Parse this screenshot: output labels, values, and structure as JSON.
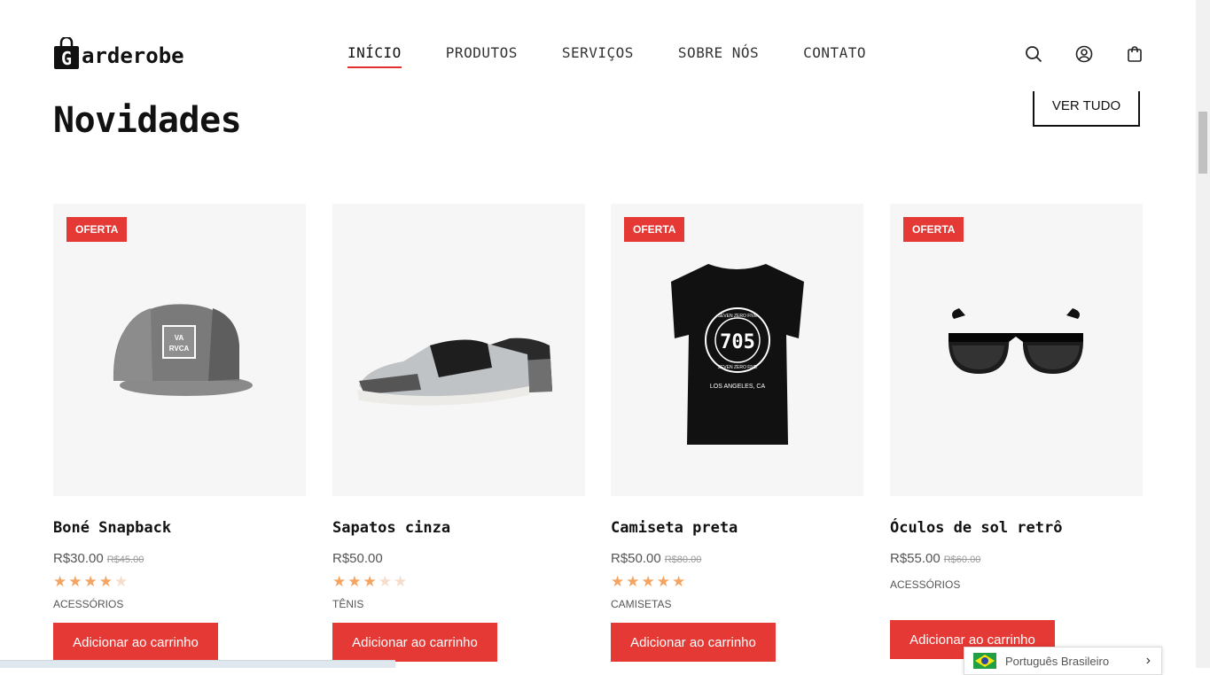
{
  "brand": {
    "logo_letter": "G",
    "name": "arderobe"
  },
  "nav": [
    {
      "label": "INÍCIO",
      "active": true
    },
    {
      "label": "PRODUTOS"
    },
    {
      "label": "SERVIÇOS"
    },
    {
      "label": "SOBRE NÓS"
    },
    {
      "label": "CONTATO"
    }
  ],
  "header_icons": [
    "search-icon",
    "user-icon",
    "cart-icon"
  ],
  "section": {
    "title": "Novidades",
    "view_all": "VER TUDO"
  },
  "products": [
    {
      "badge": "OFERTA",
      "name": "Boné Snapback",
      "price": "R$30.00",
      "old_price": "R$45.00",
      "rating": 4,
      "category": "ACESSÓRIOS",
      "button": "Adicionar ao carrinho"
    },
    {
      "badge": "",
      "name": "Sapatos cinza",
      "price": "R$50.00",
      "old_price": "",
      "rating": 3,
      "category": "TÊNIS",
      "button": "Adicionar ao carrinho"
    },
    {
      "badge": "OFERTA",
      "name": "Camiseta preta",
      "price": "R$50.00",
      "old_price": "R$80.00",
      "rating": 5,
      "category": "CAMISETAS",
      "button": "Adicionar ao carrinho"
    },
    {
      "badge": "OFERTA",
      "name": "Óculos de sol retrô",
      "price": "R$55.00",
      "old_price": "R$60.00",
      "rating": 0,
      "category": "ACESSÓRIOS",
      "button": "Adicionar ao carrinho"
    }
  ],
  "shirt_print": {
    "number": "705",
    "ring_text": "SEVEN ZERO FIVE",
    "city": "LOS ANGELES, CA"
  },
  "cap_logo": {
    "line1": "VA",
    "line2": "RVCA"
  },
  "language": {
    "label": "Português Brasileiro"
  },
  "colors": {
    "accent": "#e53935",
    "star": "#f4a460"
  }
}
